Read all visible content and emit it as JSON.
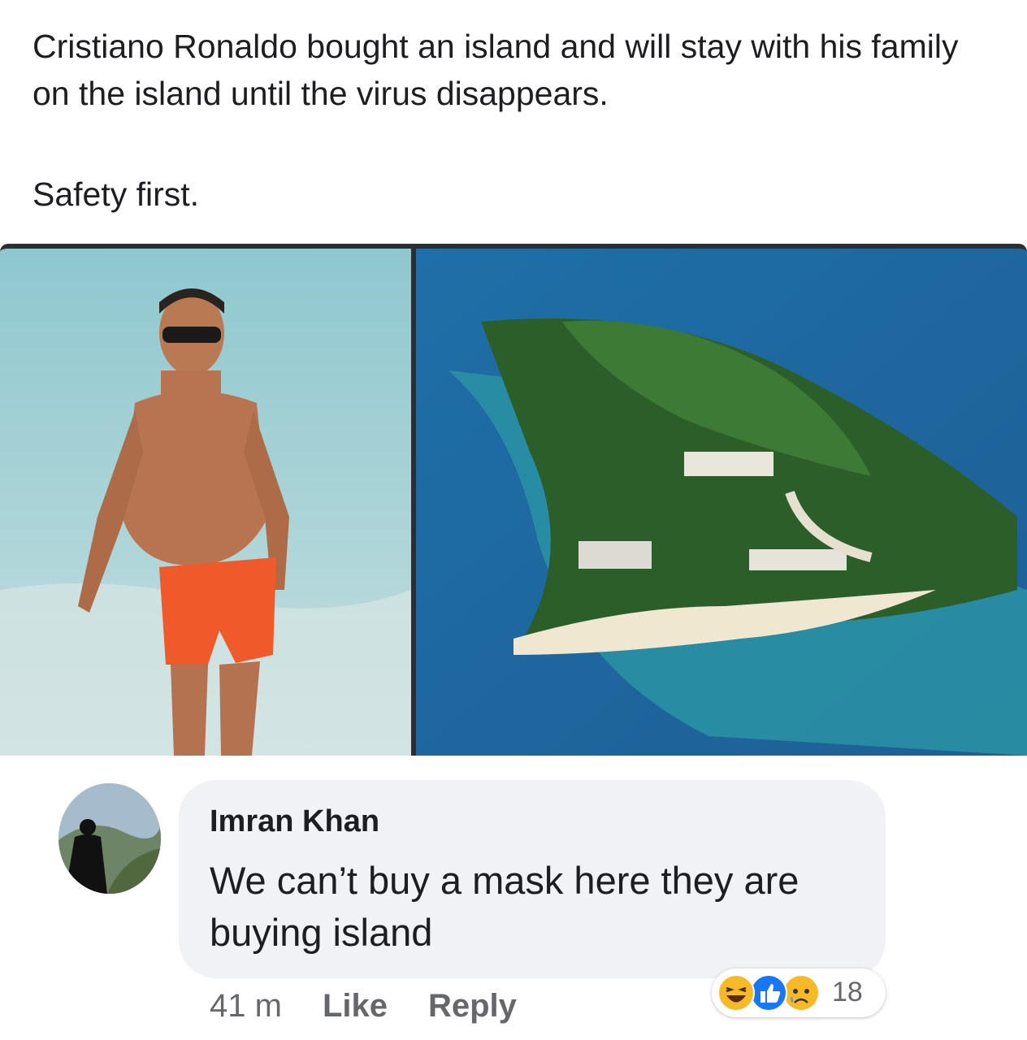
{
  "post": {
    "text_line1": "Cristiano Ronaldo bought an island and will stay with his family on the island until the virus disappears.",
    "text_line2": "Safety first."
  },
  "images": {
    "left": "person-on-beach-photo",
    "right": "aerial-island-photo"
  },
  "comment": {
    "author": "Imran Khan",
    "text": "We can’t buy a mask here they are buying island",
    "time": "41 m",
    "like_label": "Like",
    "reply_label": "Reply",
    "reaction_count": "18",
    "reactions": [
      "haha-icon",
      "like-icon",
      "sad-icon"
    ]
  },
  "colors": {
    "bubble": "#f0f2f5",
    "like_blue": "#1877f2",
    "reaction_yellow": "#f7b928",
    "meta_gray": "#65676b"
  }
}
